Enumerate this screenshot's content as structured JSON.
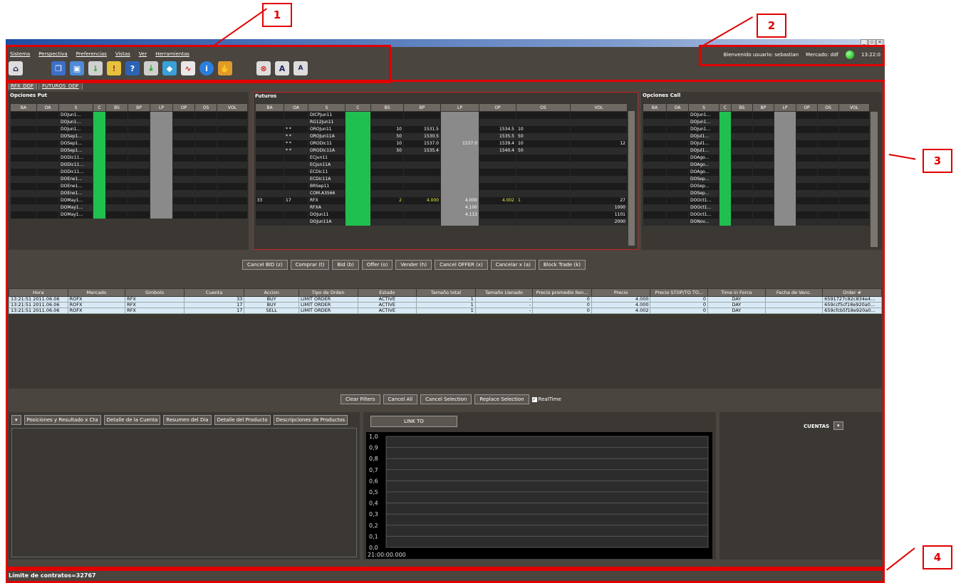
{
  "annotations": [
    "1",
    "2",
    "3",
    "4"
  ],
  "window": {
    "controls": [
      "_",
      "▫",
      "×"
    ]
  },
  "menu": [
    "Sistema",
    "Perspectiva",
    "Preferencias",
    "Vistas",
    "Ver",
    "Herramientas"
  ],
  "toolbar_icons": [
    "home-icon",
    "windows-icon",
    "window-new-icon",
    "download-icon",
    "alert-icon",
    "help-book-icon",
    "download-green-icon",
    "chart-3d-icon",
    "chart-line-icon",
    "info-icon",
    "handshake-icon",
    "cancel-icon",
    "font-up-icon",
    "font-down-icon"
  ],
  "header": {
    "welcome": "Bienvenido usuario: sebastian",
    "market": "Mercado: ddf",
    "time": "13:22:0"
  },
  "tabs": [
    "RFX_DDF",
    "FUTUROS_DDF"
  ],
  "put": {
    "title": "Opciones Put",
    "columns": [
      "BA",
      "OA",
      "S",
      "C",
      "BS",
      "BP",
      "LP",
      "OP",
      "OS",
      "VOL"
    ],
    "symbols": [
      "DOJun1...",
      "DOJun1...",
      "DOJun1...",
      "DOSep1...",
      "DOSep1...",
      "DOSep1...",
      "DODic11...",
      "DODic11...",
      "DODic11...",
      "DOEne1...",
      "DOEne1...",
      "DOEne1...",
      "DOMay1...",
      "DOMay1...",
      "DOMay1..."
    ]
  },
  "futures": {
    "title": "Futuros",
    "columns": [
      "BA",
      "OA",
      "S",
      "C",
      "BS",
      "BP",
      "LP",
      "OP",
      "OS",
      "VOL"
    ],
    "rows": [
      [
        "",
        "",
        "DICPJun11",
        "",
        "",
        "",
        "",
        "",
        "",
        ""
      ],
      [
        "",
        "",
        "RG12Jun11",
        "",
        "",
        "",
        "",
        "",
        "",
        ""
      ],
      [
        "",
        "* *",
        "OROJun11",
        "",
        "10",
        "1531.5",
        "",
        "1534.5",
        "10",
        ""
      ],
      [
        "",
        "* *",
        "OROJun11A",
        "",
        "50",
        "1530.5",
        "",
        "1535.5",
        "50",
        ""
      ],
      [
        "",
        "* *",
        "ORODic11",
        "",
        "10",
        "1537.0",
        "1537.0",
        "1539.4",
        "10",
        "12"
      ],
      [
        "",
        "* *",
        "ORODic11A",
        "",
        "50",
        "1535.4",
        "",
        "1540.4",
        "50",
        ""
      ],
      [
        "",
        "",
        "ECJun11",
        "",
        "",
        "",
        "",
        "",
        "",
        ""
      ],
      [
        "",
        "",
        "ECJun11A",
        "",
        "",
        "",
        "",
        "",
        "",
        ""
      ],
      [
        "",
        "",
        "ECDic11",
        "",
        "",
        "",
        "",
        "",
        "",
        ""
      ],
      [
        "",
        "",
        "ECDic11A",
        "",
        "",
        "",
        "",
        "",
        "",
        ""
      ],
      [
        "",
        "",
        "BRSep11",
        "",
        "",
        "",
        "",
        "",
        "",
        ""
      ],
      [
        "",
        "",
        "COM.A3566",
        "",
        "",
        "",
        "",
        "",
        "",
        ""
      ],
      [
        "33",
        "17",
        "RFX",
        "",
        "2",
        "4.000",
        "4.000",
        "4.002",
        "1",
        "27"
      ],
      [
        "",
        "",
        "RFXA",
        "",
        "",
        "",
        "4.100",
        "",
        "",
        "1000"
      ],
      [
        "",
        "",
        "DOJun11",
        "",
        "",
        "",
        "4.113",
        "",
        "",
        "1101"
      ],
      [
        "",
        "",
        "DOJun11A",
        "",
        "",
        "",
        "",
        "",
        "",
        "2000"
      ]
    ]
  },
  "call": {
    "title": "Opciones Call",
    "columns": [
      "BA",
      "OA",
      "S",
      "C",
      "BS",
      "BP",
      "LP",
      "OP",
      "OS",
      "VOL"
    ],
    "symbols": [
      "DOJun1...",
      "DOJun1...",
      "DOJun1...",
      "DOJul1...",
      "DOJul1...",
      "DOJul1...",
      "DOAgo...",
      "DOAgo...",
      "DOAgo...",
      "DOSep...",
      "DOSep...",
      "DOSep...",
      "DOOct1...",
      "DOOct1...",
      "DOOct1...",
      "DONov..."
    ]
  },
  "trade_buttons": [
    "Cancel BID (z)",
    "Comprar (t)",
    "Bid (b)",
    "Offer (o)",
    "Vender (h)",
    "Cancel OFFER (x)",
    "Cancelar x (a)",
    "Block Trade (k)"
  ],
  "orders": {
    "columns": [
      "Hora",
      "Mercado",
      "Simbolo",
      "Cuenta",
      "Accion",
      "Tipo de Orden",
      "Estado",
      "Tamaño total",
      "Tamaño Llenado",
      "Precio promedio llen...",
      "Precio",
      "Precio STOP/TO TO...",
      "Time in Force",
      "Fecha de Venc.",
      "Order #"
    ],
    "rows": [
      [
        "13:21:51 2011.06.06",
        "ROFX",
        "RFX",
        "33",
        "BUY",
        "LIMIT ORDER",
        "ACTIVE",
        "1",
        "-",
        "0",
        "4.000",
        "0",
        "DAY",
        "",
        "6591727c82c834e4..."
      ],
      [
        "13:21:51 2011.06.06",
        "ROFX",
        "RFX",
        "17",
        "BUY",
        "LIMIT ORDER",
        "ACTIVE",
        "1",
        "-",
        "0",
        "4.000",
        "0",
        "DAY",
        "",
        "659ccf5cf18e920a0..."
      ],
      [
        "13:21:51 2011.06.06",
        "ROFX",
        "RFX",
        "17",
        "SELL",
        "LIMIT ORDER",
        "ACTIVE",
        "1",
        "-",
        "0",
        "4.002",
        "0",
        "DAY",
        "",
        "659cfcb5f18e920a0..."
      ]
    ]
  },
  "order_buttons": [
    "Clear Filters",
    "Cancel All",
    "Cancel Selection",
    "Replace Selection"
  ],
  "realtime_label": "RealTime",
  "bottom_tabs": [
    "Posiciones y Resultado x Cta",
    "Detalle de la Cuenta",
    "Resumen del Dia",
    "Detalle del Producto",
    "Descripciones de Productos"
  ],
  "link_to": "LINK TO",
  "chart_data": {
    "type": "line",
    "yticks": [
      "1,0",
      "0,9",
      "0,8",
      "0,7",
      "0,6",
      "0,5",
      "0,4",
      "0,3",
      "0,2",
      "0,1",
      "0,0"
    ],
    "xtick": "21:00:00.000",
    "series": []
  },
  "cuentas_label": "CUENTAS",
  "status": "Límite de contratos=32767"
}
